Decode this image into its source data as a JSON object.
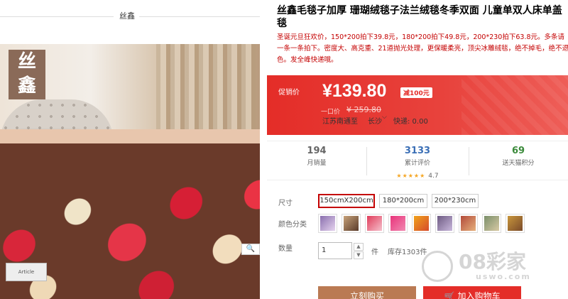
{
  "store": {
    "name": "丝鑫"
  },
  "hero": {
    "logo_top": "丝",
    "logo_bottom": "鑫",
    "book_text": "Article",
    "zoom_glyph": "🔍"
  },
  "product": {
    "title": "丝鑫毛毯子加厚 珊瑚绒毯子法兰绒毯冬季双面 儿童单双人床单盖毯",
    "subtitle": "圣诞元旦狂欢价，150*200拍下39.8元，180*200拍下49.8元，200*230拍下63.8元。多条请一条一条拍下。密度大、高克重、21道抛光处理，更保暖柔亮，顶尖冰雕绒毯，绝不掉毛，绝不退色。发全峰快递哦。"
  },
  "price": {
    "promo_label": "促销价",
    "promo_price": "¥139.80",
    "discount_tag": "减100元",
    "orig_label": "一口价",
    "orig_price": "¥ 259.80",
    "ship_from": "江苏南通",
    "ship_to_label": "至",
    "ship_to": "长沙",
    "ship_fee": "快递: 0.00",
    "colors": {
      "band": "#e42d28",
      "text": "#ffffff"
    }
  },
  "stats": [
    {
      "value": "194",
      "label": "月销量",
      "color": "#666666"
    },
    {
      "value": "3133",
      "label": "累计评价",
      "color": "#3b6fb6",
      "stars": "★★★★★",
      "rating": "4.7"
    },
    {
      "value": "69",
      "label": "送天猫积分",
      "color": "#3a8a3a"
    }
  ],
  "options": {
    "size_label": "尺寸",
    "sizes": [
      "150cmX200cm",
      "180*200cm",
      "200*230cm"
    ],
    "color_label": "颜色分类",
    "qty_label": "数量",
    "qty_value": "1",
    "qty_unit": "件",
    "stock": "库存1303件"
  },
  "actions": {
    "buy_now": "立刻购买",
    "add_cart": "加入购物车"
  },
  "watermark": {
    "main": "08彩家",
    "sub": "uswo.com"
  }
}
